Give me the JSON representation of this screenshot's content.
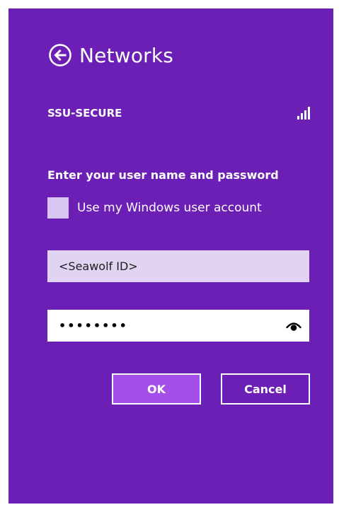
{
  "header": {
    "title": "Networks",
    "back_icon": "back-arrow-circle-icon"
  },
  "network": {
    "name": "SSU-SECURE",
    "signal_icon": "signal-strength-icon",
    "signal_bars": 4
  },
  "form": {
    "prompt": "Enter your user name and password",
    "use_windows_account_label": "Use my Windows user account",
    "use_windows_account_checked": false,
    "username_placeholder": "<Seawolf ID>",
    "username_value": "",
    "password_value": "••••••••",
    "reveal_icon": "eye-icon"
  },
  "buttons": {
    "ok_label": "OK",
    "cancel_label": "Cancel"
  },
  "colors": {
    "panel_background": "#6b1fb4",
    "ok_button": "#a54ee8",
    "username_field": "#e1d3f2",
    "checkbox": "#d9c6f0"
  }
}
